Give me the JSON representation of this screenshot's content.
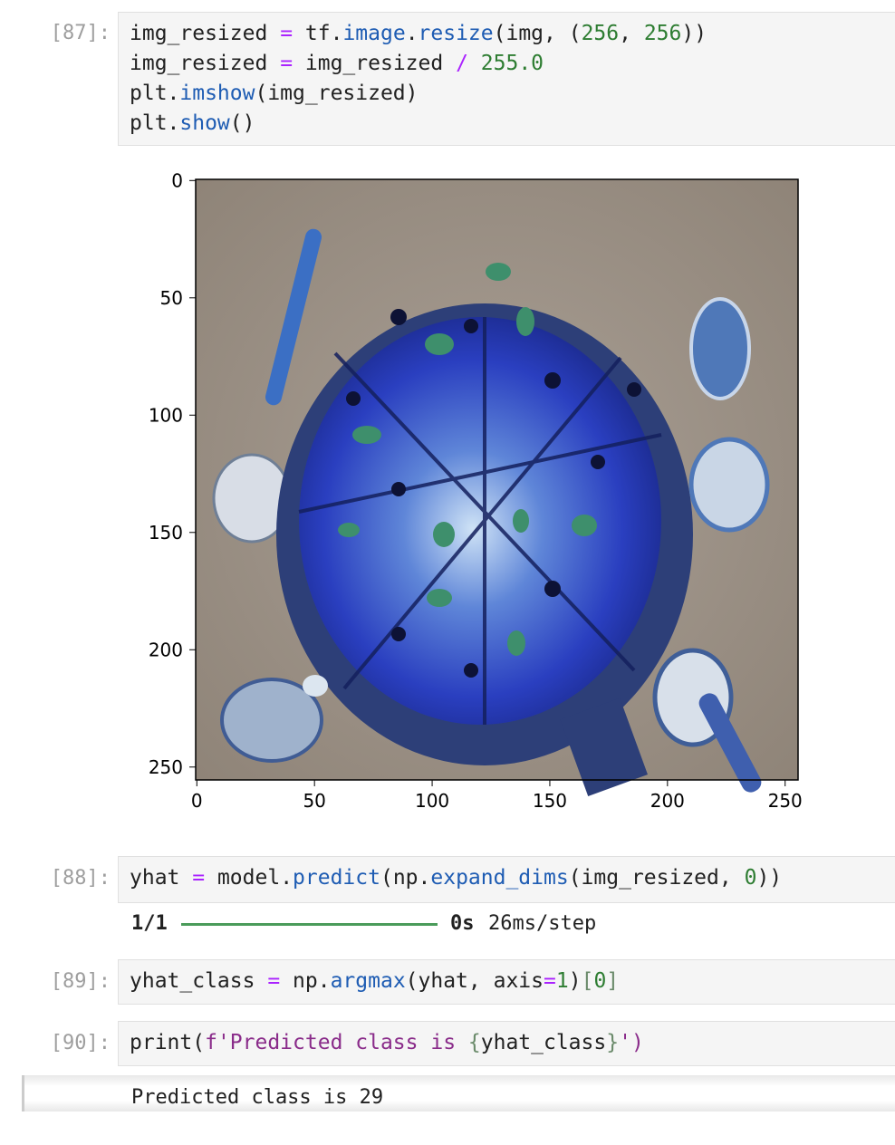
{
  "cells": [
    {
      "prompt": "[87]:",
      "lines": [
        [
          "img_resized",
          " ",
          "=",
          " tf.",
          "image",
          ".",
          "resize",
          "(img, (",
          "256",
          ", ",
          "256",
          "))"
        ],
        [
          "img_resized",
          " ",
          "=",
          " img_resized ",
          "/",
          " ",
          "255.0"
        ],
        [
          "plt.",
          "imshow",
          "(img_resized)"
        ],
        [
          "plt.",
          "show",
          "()"
        ]
      ]
    },
    {
      "prompt": "[88]:",
      "lines": [
        [
          "yhat ",
          "=",
          " model.",
          "predict",
          "(np.",
          "expand_dims",
          "(img_resized, ",
          "0",
          "))"
        ]
      ]
    },
    {
      "prompt": "[89]:",
      "lines": [
        [
          "yhat_class ",
          "=",
          " np.",
          "argmax",
          "(yhat, axis",
          "=",
          "1",
          ")",
          "[",
          "0",
          "]"
        ]
      ]
    },
    {
      "prompt": "[90]:",
      "lines": [
        [
          "print(",
          "f'Predicted class is ",
          "{",
          "yhat_class",
          "}",
          "')"
        ]
      ]
    }
  ],
  "plot": {
    "image_description_icon": "blue-tinted-pizza-image",
    "xticks": [
      "0",
      "50",
      "100",
      "150",
      "200",
      "250"
    ],
    "yticks": [
      "0",
      "50",
      "100",
      "150",
      "200",
      "250"
    ]
  },
  "progress": {
    "step": "1/1",
    "fraction": 1.0,
    "time": "0s",
    "rate": "26ms/step",
    "bar_color": "#4a9b5a"
  },
  "result": {
    "text": "Predicted class is 29"
  },
  "colors": {
    "operator": "#aa22ff",
    "number": "#2e7d32",
    "function": "#1e5cb3",
    "string": "#8a2c8a"
  }
}
